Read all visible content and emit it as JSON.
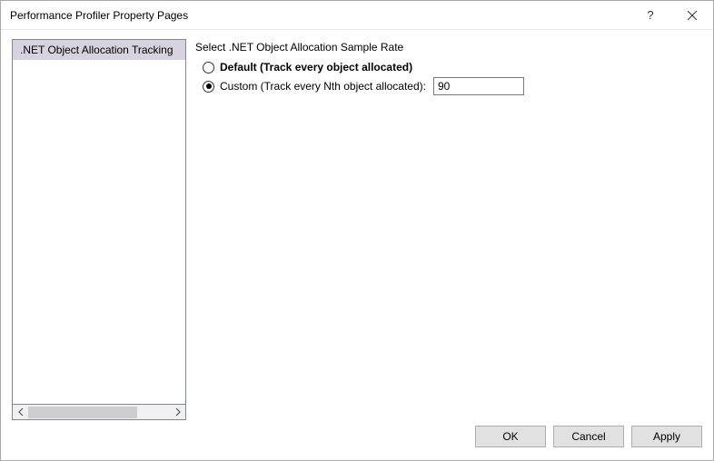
{
  "window": {
    "title": "Performance Profiler Property Pages"
  },
  "sidebar": {
    "items": [
      {
        "label": ".NET Object Allocation Tracking"
      }
    ]
  },
  "main": {
    "section_label": "Select .NET Object Allocation Sample Rate",
    "options": {
      "default_label": "Default (Track every object allocated)",
      "custom_label": "Custom (Track every Nth object allocated):",
      "selected": "custom",
      "custom_value": "90"
    }
  },
  "footer": {
    "ok": "OK",
    "cancel": "Cancel",
    "apply": "Apply"
  }
}
